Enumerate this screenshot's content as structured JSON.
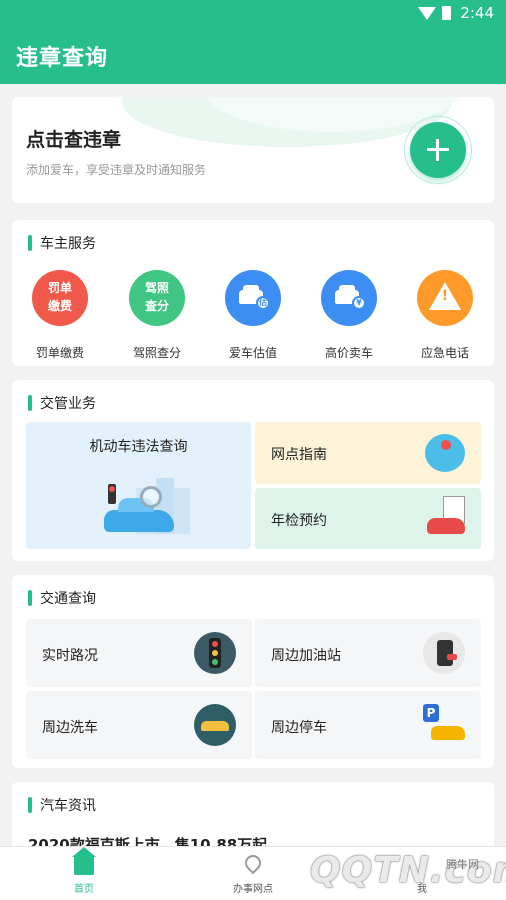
{
  "status_bar": {
    "time": "2:44"
  },
  "app_bar": {
    "title": "违章查询"
  },
  "hero": {
    "title": "点击查违章",
    "subtitle": "添加爱车，享受违章及时通知服务",
    "add_icon": "plus-icon"
  },
  "owner_services": {
    "heading": "车主服务",
    "items": [
      {
        "label": "罚单缴费",
        "icon_text": "罚单\n缴费",
        "color": "#f15a4a"
      },
      {
        "label": "驾照查分",
        "icon_text": "驾照\n查分",
        "color": "#41c582"
      },
      {
        "label": "爱车估值",
        "icon": "car-valuation-icon",
        "color": "#3c8ef2"
      },
      {
        "label": "高价卖车",
        "icon": "car-sell-icon",
        "color": "#3c8ef2"
      },
      {
        "label": "应急电话",
        "icon": "warning-icon",
        "color": "#ff9a2a"
      }
    ]
  },
  "traffic_management": {
    "heading": "交管业务",
    "big_tile": "机动车违法查询",
    "tiles": [
      "网点指南",
      "年检预约"
    ]
  },
  "traffic_query": {
    "heading": "交通查询",
    "items": [
      "实时路况",
      "周边加油站",
      "周边洗车",
      "周边停车"
    ]
  },
  "news": {
    "heading": "汽车资讯",
    "headline": "2020款福克斯上市，售10.88万起"
  },
  "bottom_nav": {
    "items": [
      {
        "label": "首页",
        "icon": "home-icon",
        "active": true
      },
      {
        "label": "办事网点",
        "icon": "location-pin-icon",
        "active": false
      },
      {
        "label": "我",
        "icon": "profile-icon",
        "active": false
      }
    ]
  },
  "watermark": {
    "logo": "QQTN.com",
    "site": "腾牛网"
  },
  "colors": {
    "primary": "#26bf8c",
    "background": "#f2f2f2"
  }
}
